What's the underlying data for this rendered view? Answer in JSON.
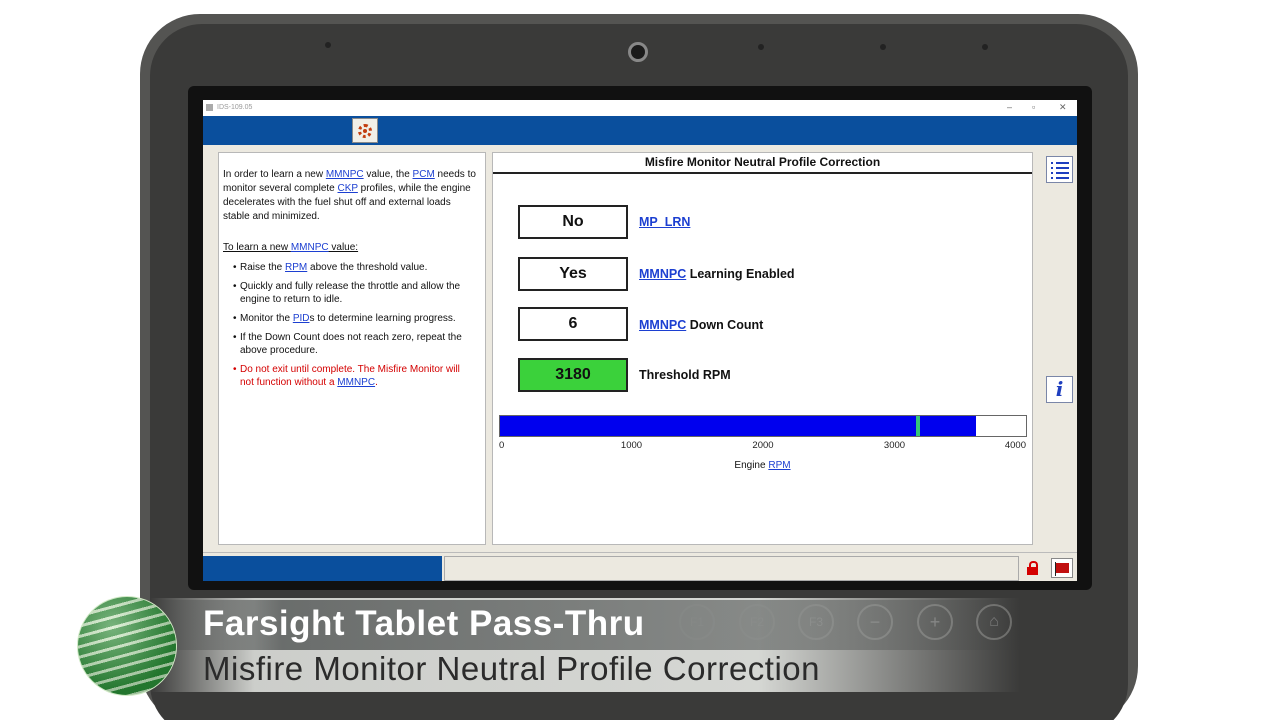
{
  "window": {
    "title": "IDS-109.05"
  },
  "left_panel": {
    "intro_parts": [
      "In order to learn a new ",
      "MMNPC",
      " value, the ",
      "PCM",
      " needs to monitor several complete ",
      "CKP",
      " profiles, while the engine decelerates with the fuel shut off and external loads stable and minimized."
    ],
    "learn_heading_parts": [
      "To learn a new ",
      "MMNPC",
      " value:"
    ],
    "bullet1_parts": [
      "Raise the ",
      "RPM",
      " above the threshold value."
    ],
    "bullet2": "Quickly and fully release the throttle and allow the engine to return to idle.",
    "bullet3_parts": [
      "Monitor the ",
      "PID",
      "s to determine learning progress."
    ],
    "bullet4": "If the Down Count does not reach zero, repeat the above procedure.",
    "bullet5_parts": [
      "Do not exit until complete. The Misfire Monitor will not function without a ",
      "MMNPC",
      "."
    ]
  },
  "main_panel": {
    "title": "Misfire Monitor Neutral Profile Correction",
    "rows": [
      {
        "value": "No",
        "label_link": "MP_LRN",
        "label_rest": ""
      },
      {
        "value": "Yes",
        "label_link": "MMNPC",
        "label_rest": " Learning Enabled"
      },
      {
        "value": "6",
        "label_link": "MMNPC",
        "label_rest": " Down Count"
      },
      {
        "value": "3180",
        "label_link": "",
        "label_rest": "Threshold RPM"
      }
    ],
    "threshold_color": "#3bd13b",
    "gauge": {
      "min": 0,
      "max": 4000,
      "current_rpm": 3620,
      "threshold_rpm": 3180,
      "ticks": [
        "0",
        "1000",
        "2000",
        "3000",
        "4000"
      ],
      "axis_label_prefix": "Engine ",
      "axis_label_link": "RPM",
      "fill_color": "#0000ee",
      "marker_color": "#35c47a"
    }
  },
  "side_buttons": {
    "list_icon": "list-icon",
    "info_icon": "info-icon"
  },
  "status_bar": {
    "lock_icon": "lock-icon",
    "flag_icon": "flag-icon"
  },
  "hardware_buttons": [
    "F1",
    "F2",
    "F3",
    "−",
    "+",
    "home-icon"
  ],
  "caption": {
    "line1": "Farsight Tablet Pass-Thru",
    "line2": "Misfire Monitor Neutral Profile Correction"
  },
  "colors": {
    "app_blue": "#0a4f9d",
    "link_blue": "#1c3fd1",
    "warning_red": "#d40000"
  }
}
